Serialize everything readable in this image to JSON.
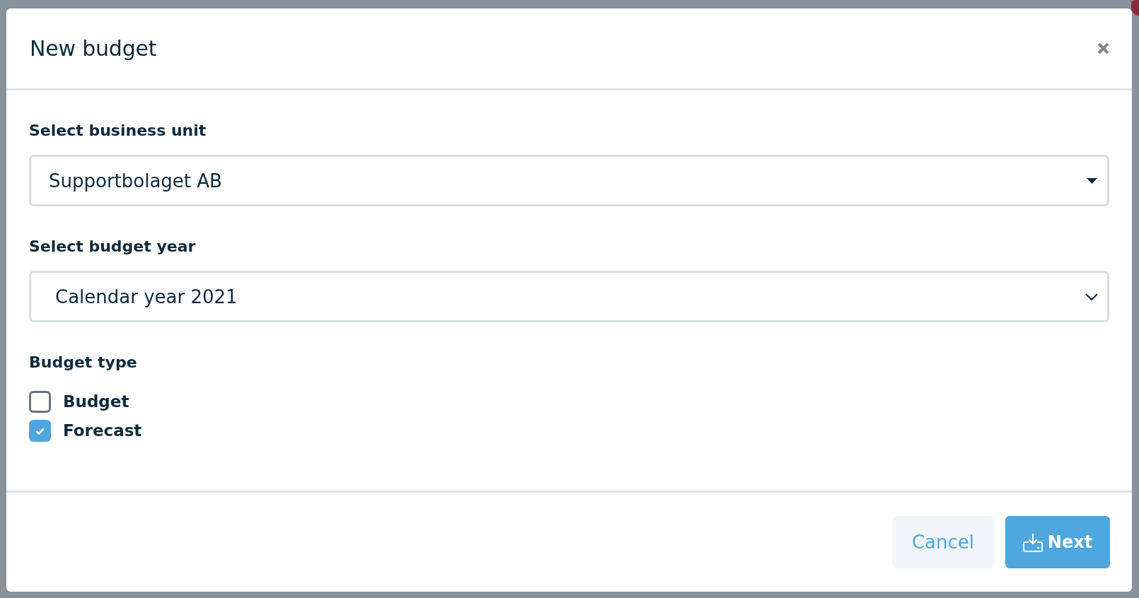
{
  "dialog": {
    "title": "New budget"
  },
  "fields": [
    {
      "kind": "dropdown",
      "label": "Select business unit",
      "value": "Supportbolaget AB"
    },
    {
      "kind": "select",
      "label": "Select budget year",
      "value": "Calendar year 2021"
    }
  ],
  "budget_type": {
    "label": "Budget type",
    "options": [
      {
        "label": "Budget",
        "checked": false
      },
      {
        "label": "Forecast",
        "checked": true
      }
    ]
  },
  "buttons": [
    {
      "kind": "secondary",
      "label": "Cancel"
    },
    {
      "kind": "primary",
      "label": "Next"
    }
  ]
}
